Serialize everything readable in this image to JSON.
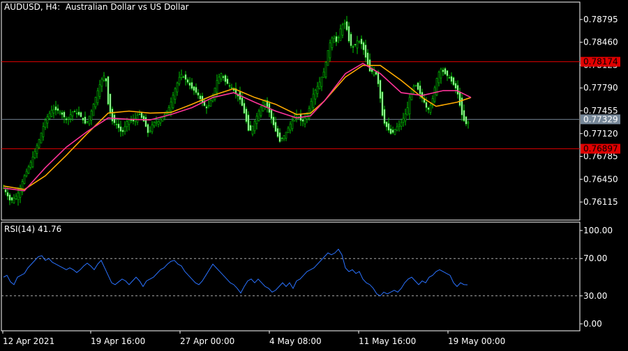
{
  "header": {
    "title": "AUDUSD, H4:  Australian Dollar vs US Dollar"
  },
  "rsi_header": {
    "label": "RSI(14) 41.76"
  },
  "colors": {
    "background": "#000000",
    "frame": "#ffffff",
    "bull_bar": "#00c800",
    "bear_bar": "#c8ffc8",
    "ma_fast": "#ff3399",
    "ma_slow": "#ffaa00",
    "level_line": "#e00000",
    "level_label_bg": "#e00000",
    "bid_line": "#708090",
    "bid_label_bg": "#778899",
    "rsi_line": "#2a72ff",
    "rsi_level": "#aaaaaa"
  },
  "chart_data": [
    {
      "type": "candlestick",
      "symbol": "AUDUSD",
      "timeframe": "H4",
      "title": "AUDUSD, H4:  Australian Dollar vs US Dollar",
      "ylim": [
        0.7585,
        0.7905
      ],
      "price_ticks": [
        "0.78795",
        "0.78460",
        "0.78125",
        "0.77790",
        "0.77455",
        "0.77120",
        "0.76785",
        "0.76450",
        "0.76115"
      ],
      "highlighted_labels": [
        {
          "text": "0.78174",
          "value": 0.78174,
          "color": "#e00000"
        },
        {
          "text": "0.77329",
          "value": 0.77329,
          "color": "#778899"
        },
        {
          "text": "0.76897",
          "value": 0.76897,
          "color": "#e00000"
        }
      ],
      "time_labels": [
        "12 Apr 2021",
        "19 Apr 16:00",
        "27 Apr 00:00",
        "4 May 08:00",
        "11 May 16:00",
        "19 May 00:00"
      ],
      "close_path": [
        [
          0,
          0.7632
        ],
        [
          10,
          0.7612
        ],
        [
          20,
          0.7622
        ],
        [
          30,
          0.765
        ],
        [
          40,
          0.7672
        ],
        [
          50,
          0.77
        ],
        [
          60,
          0.7732
        ],
        [
          70,
          0.7748
        ],
        [
          80,
          0.7745
        ],
        [
          90,
          0.7732
        ],
        [
          100,
          0.7745
        ],
        [
          110,
          0.7738
        ],
        [
          118,
          0.7725
        ],
        [
          126,
          0.7745
        ],
        [
          134,
          0.7772
        ],
        [
          140,
          0.779
        ],
        [
          146,
          0.78
        ],
        [
          150,
          0.7755
        ],
        [
          156,
          0.773
        ],
        [
          162,
          0.7725
        ],
        [
          170,
          0.7712
        ],
        [
          178,
          0.7732
        ],
        [
          186,
          0.773
        ],
        [
          194,
          0.7742
        ],
        [
          202,
          0.7728
        ],
        [
          208,
          0.771
        ],
        [
          214,
          0.7728
        ],
        [
          222,
          0.773
        ],
        [
          230,
          0.7738
        ],
        [
          238,
          0.7752
        ],
        [
          246,
          0.7778
        ],
        [
          254,
          0.78
        ],
        [
          262,
          0.779
        ],
        [
          270,
          0.7778
        ],
        [
          278,
          0.777
        ],
        [
          286,
          0.7755
        ],
        [
          292,
          0.7748
        ],
        [
          300,
          0.7768
        ],
        [
          306,
          0.779
        ],
        [
          312,
          0.78
        ],
        [
          318,
          0.7788
        ],
        [
          326,
          0.778
        ],
        [
          334,
          0.777
        ],
        [
          340,
          0.776
        ],
        [
          346,
          0.7738
        ],
        [
          352,
          0.7712
        ],
        [
          358,
          0.7725
        ],
        [
          366,
          0.7745
        ],
        [
          374,
          0.7762
        ],
        [
          382,
          0.774
        ],
        [
          390,
          0.7715
        ],
        [
          396,
          0.77
        ],
        [
          404,
          0.7712
        ],
        [
          412,
          0.7728
        ],
        [
          420,
          0.774
        ],
        [
          428,
          0.7728
        ],
        [
          436,
          0.7742
        ],
        [
          444,
          0.777
        ],
        [
          452,
          0.7785
        ],
        [
          460,
          0.7805
        ],
        [
          466,
          0.784
        ],
        [
          472,
          0.7855
        ],
        [
          478,
          0.7845
        ],
        [
          484,
          0.787
        ],
        [
          490,
          0.7875
        ],
        [
          496,
          0.7842
        ],
        [
          502,
          0.7838
        ],
        [
          508,
          0.785
        ],
        [
          514,
          0.7842
        ],
        [
          520,
          0.782
        ],
        [
          526,
          0.78
        ],
        [
          532,
          0.7808
        ],
        [
          538,
          0.778
        ],
        [
          544,
          0.773
        ],
        [
          550,
          0.772
        ],
        [
          556,
          0.771
        ],
        [
          562,
          0.772
        ],
        [
          570,
          0.7728
        ],
        [
          578,
          0.7745
        ],
        [
          584,
          0.7775
        ],
        [
          590,
          0.7785
        ],
        [
          596,
          0.7772
        ],
        [
          602,
          0.776
        ],
        [
          608,
          0.7745
        ],
        [
          614,
          0.7758
        ],
        [
          620,
          0.779
        ],
        [
          626,
          0.7808
        ],
        [
          632,
          0.78
        ],
        [
          638,
          0.7795
        ],
        [
          644,
          0.7785
        ],
        [
          650,
          0.7775
        ],
        [
          656,
          0.7742
        ],
        [
          662,
          0.7725
        ],
        [
          668,
          0.773
        ]
      ],
      "ma_fast": [
        [
          0,
          0.7632
        ],
        [
          30,
          0.7628
        ],
        [
          60,
          0.7662
        ],
        [
          90,
          0.7692
        ],
        [
          120,
          0.7715
        ],
        [
          150,
          0.7735
        ],
        [
          180,
          0.7733
        ],
        [
          210,
          0.7732
        ],
        [
          240,
          0.774
        ],
        [
          270,
          0.775
        ],
        [
          300,
          0.7765
        ],
        [
          330,
          0.7772
        ],
        [
          360,
          0.7758
        ],
        [
          390,
          0.7745
        ],
        [
          420,
          0.7735
        ],
        [
          440,
          0.7738
        ],
        [
          460,
          0.776
        ],
        [
          490,
          0.78
        ],
        [
          515,
          0.7815
        ],
        [
          540,
          0.78
        ],
        [
          570,
          0.7772
        ],
        [
          600,
          0.7768
        ],
        [
          630,
          0.7775
        ],
        [
          650,
          0.7775
        ],
        [
          670,
          0.7765
        ]
      ],
      "ma_slow": [
        [
          0,
          0.7635
        ],
        [
          30,
          0.763
        ],
        [
          60,
          0.765
        ],
        [
          90,
          0.768
        ],
        [
          120,
          0.7712
        ],
        [
          150,
          0.7742
        ],
        [
          180,
          0.7745
        ],
        [
          210,
          0.7742
        ],
        [
          240,
          0.7743
        ],
        [
          270,
          0.7755
        ],
        [
          300,
          0.7768
        ],
        [
          330,
          0.7778
        ],
        [
          360,
          0.7765
        ],
        [
          390,
          0.7755
        ],
        [
          420,
          0.774
        ],
        [
          440,
          0.7742
        ],
        [
          460,
          0.776
        ],
        [
          490,
          0.7795
        ],
        [
          515,
          0.7812
        ],
        [
          540,
          0.7812
        ],
        [
          570,
          0.779
        ],
        [
          600,
          0.7765
        ],
        [
          620,
          0.7752
        ],
        [
          650,
          0.7758
        ],
        [
          670,
          0.7765
        ]
      ]
    },
    {
      "type": "line",
      "indicator": "RSI",
      "label": "RSI(14) 41.76",
      "ylim": [
        0,
        100
      ],
      "ticks": [
        "100.00",
        "70.00",
        "30.00",
        "0.00"
      ],
      "levels": [
        70,
        30
      ],
      "values": [
        [
          5,
          50
        ],
        [
          10,
          52
        ],
        [
          15,
          45
        ],
        [
          20,
          42
        ],
        [
          25,
          50
        ],
        [
          30,
          52
        ],
        [
          35,
          54
        ],
        [
          40,
          60
        ],
        [
          45,
          64
        ],
        [
          50,
          68
        ],
        [
          55,
          72
        ],
        [
          60,
          73
        ],
        [
          65,
          68
        ],
        [
          70,
          70
        ],
        [
          75,
          66
        ],
        [
          80,
          64
        ],
        [
          85,
          62
        ],
        [
          90,
          60
        ],
        [
          95,
          58
        ],
        [
          100,
          60
        ],
        [
          105,
          58
        ],
        [
          110,
          55
        ],
        [
          115,
          58
        ],
        [
          120,
          62
        ],
        [
          125,
          65
        ],
        [
          130,
          62
        ],
        [
          135,
          58
        ],
        [
          140,
          64
        ],
        [
          145,
          68
        ],
        [
          150,
          60
        ],
        [
          155,
          52
        ],
        [
          160,
          44
        ],
        [
          165,
          42
        ],
        [
          170,
          45
        ],
        [
          175,
          48
        ],
        [
          180,
          46
        ],
        [
          185,
          42
        ],
        [
          190,
          46
        ],
        [
          195,
          50
        ],
        [
          200,
          46
        ],
        [
          205,
          40
        ],
        [
          210,
          46
        ],
        [
          215,
          48
        ],
        [
          220,
          50
        ],
        [
          225,
          54
        ],
        [
          230,
          58
        ],
        [
          235,
          60
        ],
        [
          240,
          64
        ],
        [
          245,
          67
        ],
        [
          250,
          68
        ],
        [
          255,
          64
        ],
        [
          260,
          62
        ],
        [
          265,
          56
        ],
        [
          270,
          52
        ],
        [
          275,
          48
        ],
        [
          280,
          44
        ],
        [
          285,
          42
        ],
        [
          290,
          46
        ],
        [
          295,
          52
        ],
        [
          300,
          58
        ],
        [
          305,
          64
        ],
        [
          310,
          60
        ],
        [
          315,
          56
        ],
        [
          320,
          52
        ],
        [
          325,
          48
        ],
        [
          330,
          44
        ],
        [
          335,
          42
        ],
        [
          340,
          38
        ],
        [
          345,
          33
        ],
        [
          350,
          40
        ],
        [
          355,
          46
        ],
        [
          360,
          48
        ],
        [
          365,
          44
        ],
        [
          370,
          48
        ],
        [
          375,
          44
        ],
        [
          380,
          40
        ],
        [
          385,
          38
        ],
        [
          390,
          34
        ],
        [
          395,
          36
        ],
        [
          400,
          40
        ],
        [
          405,
          44
        ],
        [
          410,
          40
        ],
        [
          415,
          44
        ],
        [
          420,
          38
        ],
        [
          425,
          46
        ],
        [
          430,
          48
        ],
        [
          435,
          52
        ],
        [
          440,
          56
        ],
        [
          445,
          58
        ],
        [
          450,
          60
        ],
        [
          455,
          64
        ],
        [
          460,
          68
        ],
        [
          465,
          72
        ],
        [
          470,
          76
        ],
        [
          475,
          74
        ],
        [
          480,
          76
        ],
        [
          485,
          80
        ],
        [
          490,
          74
        ],
        [
          495,
          60
        ],
        [
          500,
          56
        ],
        [
          505,
          58
        ],
        [
          510,
          54
        ],
        [
          515,
          56
        ],
        [
          520,
          48
        ],
        [
          525,
          44
        ],
        [
          530,
          42
        ],
        [
          535,
          38
        ],
        [
          540,
          32
        ],
        [
          545,
          30
        ],
        [
          550,
          34
        ],
        [
          555,
          32
        ],
        [
          560,
          34
        ],
        [
          565,
          36
        ],
        [
          570,
          34
        ],
        [
          575,
          38
        ],
        [
          580,
          44
        ],
        [
          585,
          48
        ],
        [
          590,
          50
        ],
        [
          595,
          46
        ],
        [
          600,
          42
        ],
        [
          605,
          46
        ],
        [
          610,
          44
        ],
        [
          615,
          50
        ],
        [
          620,
          52
        ],
        [
          625,
          56
        ],
        [
          630,
          58
        ],
        [
          635,
          56
        ],
        [
          640,
          54
        ],
        [
          645,
          52
        ],
        [
          650,
          44
        ],
        [
          655,
          40
        ],
        [
          660,
          44
        ],
        [
          665,
          42
        ],
        [
          670,
          41.76
        ]
      ]
    }
  ]
}
